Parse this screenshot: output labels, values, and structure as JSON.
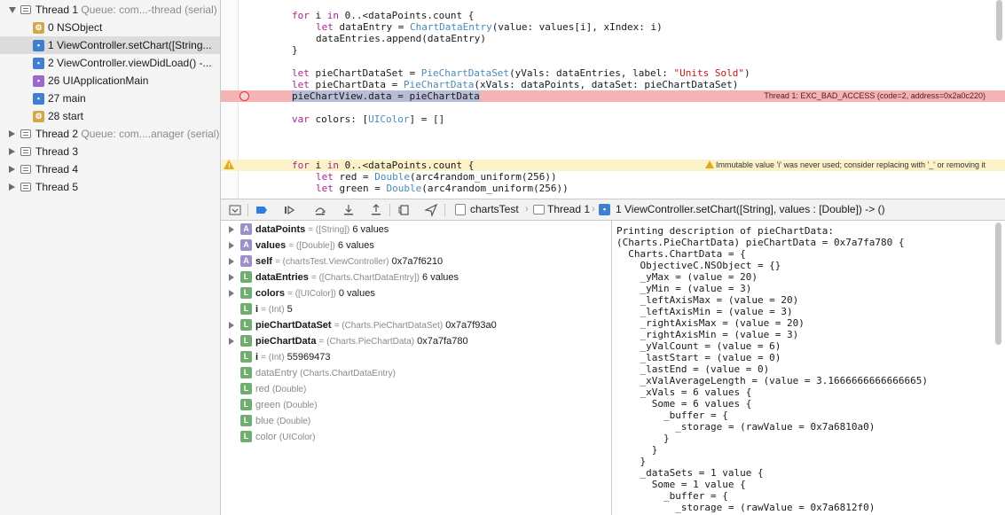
{
  "navigator": {
    "threads": [
      {
        "label": "Thread 1",
        "queue": "Queue: com...-thread (serial)",
        "expanded": true
      },
      {
        "label": "Thread 2",
        "queue": "Queue: com....anager (serial)",
        "expanded": false
      },
      {
        "label": "Thread 3",
        "queue": "",
        "expanded": false
      },
      {
        "label": "Thread 4",
        "queue": "",
        "expanded": false
      },
      {
        "label": "Thread 5",
        "queue": "",
        "expanded": false
      }
    ],
    "frames": [
      {
        "label": "0 NSObject",
        "icon": "gear-icon"
      },
      {
        "label": "1 ViewController.setChart([String...",
        "icon": "person-icon",
        "selected": true
      },
      {
        "label": "2 ViewController.viewDidLoad() -...",
        "icon": "person-icon"
      },
      {
        "label": "26 UIApplicationMain",
        "icon": "app-icon"
      },
      {
        "label": "27 main",
        "icon": "person-icon"
      },
      {
        "label": "28 start",
        "icon": "gear-icon"
      }
    ]
  },
  "editor": {
    "lines": [
      {
        "parts": [
          [
            "kw",
            "for"
          ],
          [
            "",
            "i "
          ],
          [
            "kw",
            "in"
          ],
          [
            "",
            "0..<dataPoints.count {"
          ]
        ],
        "indent": 1
      },
      {
        "parts": [
          [
            "kw",
            "let"
          ],
          [
            "",
            "dataEntry = "
          ],
          [
            "ty",
            "ChartDataEntry"
          ],
          [
            "",
            "(value: values[i], xIndex: i)"
          ]
        ],
        "indent": 2
      },
      {
        "parts": [
          [
            "",
            "dataEntries.append(dataEntry)"
          ]
        ],
        "indent": 2
      },
      {
        "parts": [
          [
            "",
            "}"
          ]
        ],
        "indent": 1
      },
      {
        "parts": [],
        "indent": 1
      },
      {
        "parts": [
          [
            "kw",
            "let"
          ],
          [
            "",
            "pieChartDataSet = "
          ],
          [
            "ty",
            "PieChartDataSet"
          ],
          [
            "",
            "(yVals: dataEntries, label: "
          ],
          [
            "str",
            "\"Units Sold\""
          ],
          [
            "",
            ")"
          ]
        ],
        "indent": 1
      },
      {
        "parts": [
          [
            "kw",
            "let"
          ],
          [
            "",
            "pieChartData = "
          ],
          [
            "ty",
            "PieChartData"
          ],
          [
            "",
            "(xVals: dataPoints, dataSet: pieChartDataSet)"
          ]
        ],
        "indent": 1
      },
      {
        "parts": [
          [
            "hl",
            "pieChartView.data = pieChartData"
          ]
        ],
        "indent": 1,
        "error": "Thread 1: EXC_BAD_ACCESS (code=2, address=0x2a0c220)"
      },
      {
        "parts": [],
        "indent": 1
      },
      {
        "parts": [
          [
            "kw",
            "var"
          ],
          [
            "",
            "colors: ["
          ],
          [
            "ty",
            "UIColor"
          ],
          [
            "",
            "] = []"
          ]
        ],
        "indent": 1
      },
      {
        "parts": [],
        "indent": 1
      },
      {
        "parts": [],
        "indent": 1
      },
      {
        "parts": [],
        "indent": 1
      },
      {
        "parts": [
          [
            "kw",
            "for"
          ],
          [
            "",
            "i "
          ],
          [
            "kw",
            "in"
          ],
          [
            "",
            "0..<dataPoints.count {"
          ]
        ],
        "indent": 1,
        "warning": "Immutable value 'i' was never used; consider replacing with '_' or removing it"
      },
      {
        "parts": [
          [
            "kw",
            "let"
          ],
          [
            "",
            "red = "
          ],
          [
            "ty",
            "Double"
          ],
          [
            "",
            "(arc4random_uniform(256))"
          ]
        ],
        "indent": 2
      },
      {
        "parts": [
          [
            "kw",
            "let"
          ],
          [
            "",
            "green = "
          ],
          [
            "ty",
            "Double"
          ],
          [
            "",
            "(arc4random_uniform(256))"
          ]
        ],
        "indent": 2
      }
    ]
  },
  "toolbar": {
    "breadcrumb": {
      "target": "chartsTest",
      "thread": "Thread 1",
      "frame": "1 ViewController.setChart([String], values : [Double]) -> ()"
    }
  },
  "variables": [
    {
      "badge": "A",
      "expandable": true,
      "name": "dataPoints",
      "type": "= ([String])",
      "value": "6 values"
    },
    {
      "badge": "A",
      "expandable": true,
      "name": "values",
      "type": "= ([Double])",
      "value": "6 values"
    },
    {
      "badge": "A",
      "expandable": true,
      "name": "self",
      "type": "= (chartsTest.ViewController)",
      "value": "0x7a7f6210"
    },
    {
      "badge": "L",
      "expandable": true,
      "name": "dataEntries",
      "type": "= ([Charts.ChartDataEntry])",
      "value": "6 values"
    },
    {
      "badge": "L",
      "expandable": true,
      "name": "colors",
      "type": "= ([UIColor])",
      "value": "0 values"
    },
    {
      "badge": "L",
      "expandable": false,
      "name": "i",
      "type": "= (Int)",
      "value": "5"
    },
    {
      "badge": "L",
      "expandable": true,
      "name": "pieChartDataSet",
      "type": "= (Charts.PieChartDataSet)",
      "value": "0x7a7f93a0"
    },
    {
      "badge": "L",
      "expandable": true,
      "name": "pieChartData",
      "type": "= (Charts.PieChartData)",
      "value": "0x7a7fa780"
    },
    {
      "badge": "L",
      "expandable": false,
      "name": "i",
      "type": "= (Int)",
      "value": "55969473"
    },
    {
      "badge": "L",
      "expandable": false,
      "dim": true,
      "name": "dataEntry",
      "type": "(Charts.ChartDataEntry)",
      "value": ""
    },
    {
      "badge": "L",
      "expandable": false,
      "dim": true,
      "name": "red",
      "type": "(Double)",
      "value": ""
    },
    {
      "badge": "L",
      "expandable": false,
      "dim": true,
      "name": "green",
      "type": "(Double)",
      "value": ""
    },
    {
      "badge": "L",
      "expandable": false,
      "dim": true,
      "name": "blue",
      "type": "(Double)",
      "value": ""
    },
    {
      "badge": "L",
      "expandable": false,
      "dim": true,
      "name": "color",
      "type": "(UIColor)",
      "value": ""
    }
  ],
  "console": {
    "lines": [
      "Printing description of pieChartData:",
      "(Charts.PieChartData) pieChartData = 0x7a7fa780 {",
      "  Charts.ChartData = {",
      "    ObjectiveC.NSObject = {}",
      "    _yMax = (value = 20)",
      "    _yMin = (value = 3)",
      "    _leftAxisMax = (value = 20)",
      "    _leftAxisMin = (value = 3)",
      "    _rightAxisMax = (value = 20)",
      "    _rightAxisMin = (value = 3)",
      "    _yValCount = (value = 6)",
      "    _lastStart = (value = 0)",
      "    _lastEnd = (value = 0)",
      "    _xValAverageLength = (value = 3.1666666666666665)",
      "    _xVals = 6 values {",
      "      Some = 6 values {",
      "        _buffer = {",
      "          _storage = (rawValue = 0x7a6810a0)",
      "        }",
      "      }",
      "    }",
      "    _dataSets = 1 value {",
      "      Some = 1 value {",
      "        _buffer = {",
      "          _storage = (rawValue = 0x7a6812f0)",
      "        }"
    ]
  }
}
